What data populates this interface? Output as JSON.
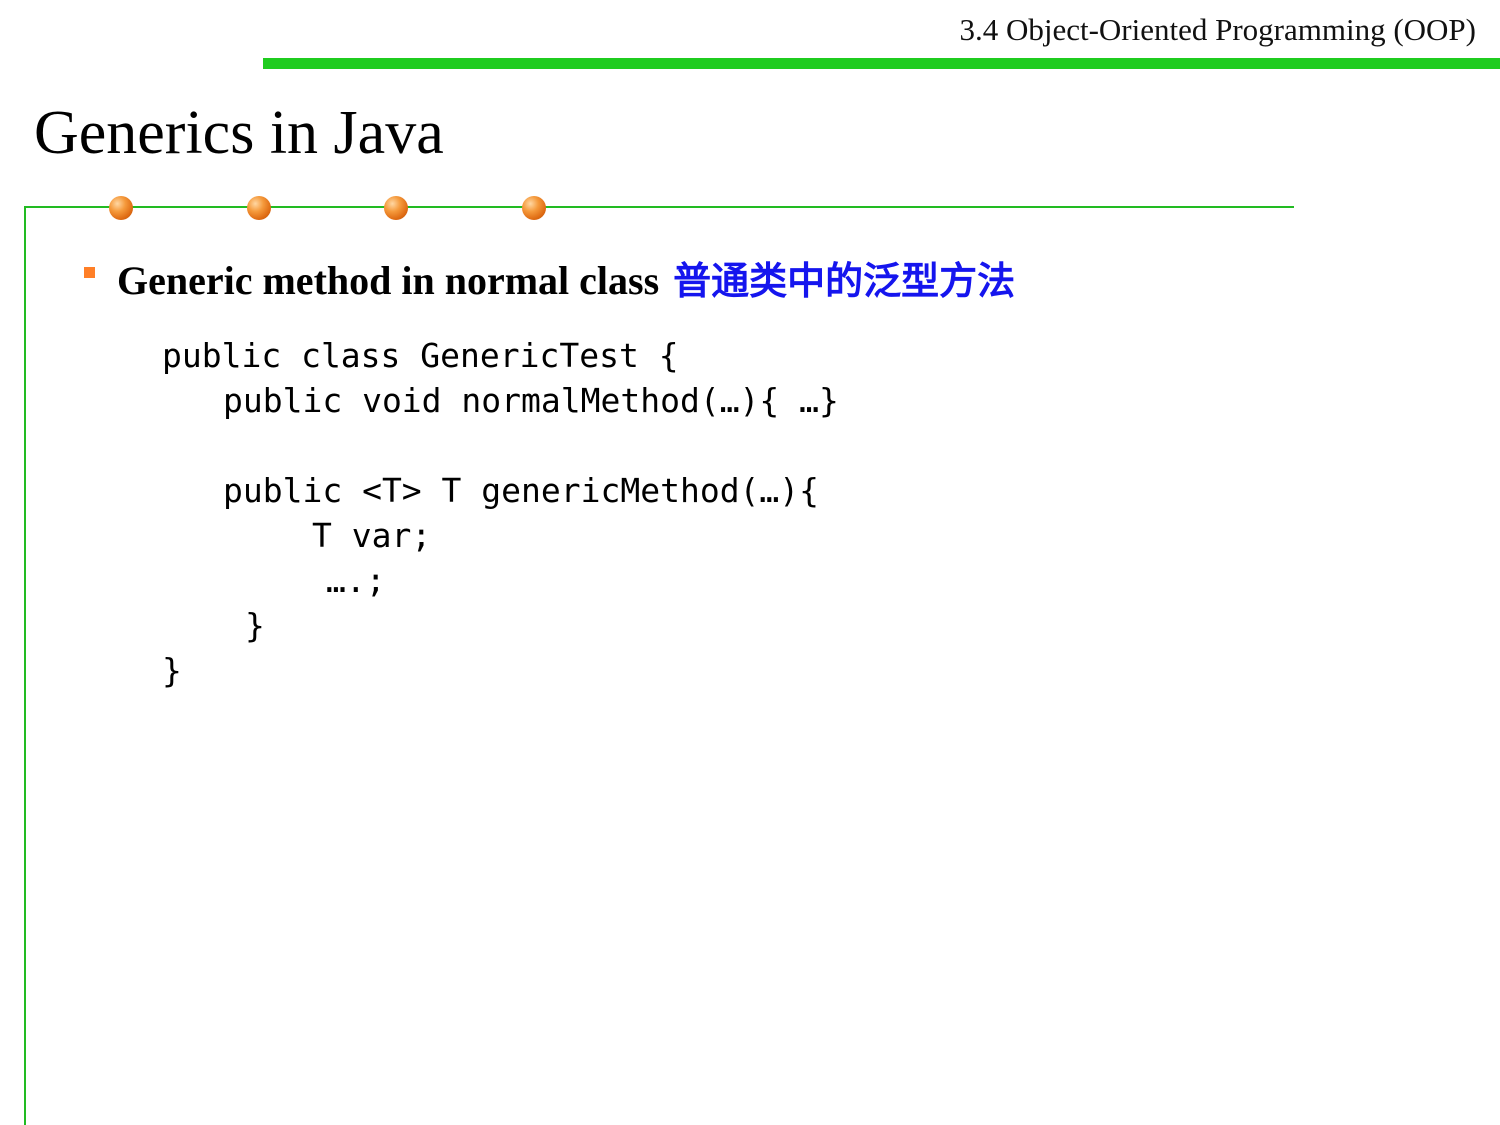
{
  "header": {
    "section_title": "3.4 Object-Oriented Programming (OOP)"
  },
  "slide": {
    "title": "Generics in Java",
    "bullet": {
      "text_en": "Generic method in normal class",
      "text_cn": "普通类中的泛型方法"
    },
    "code": [
      "public class GenericTest {",
      "public void normalMethod(…){ …}",
      "public <T> T genericMethod(…){",
      "T var;",
      "….;",
      "}",
      "}"
    ]
  },
  "colors": {
    "accent_green": "#1fcc1f",
    "frame_green": "#22bb22",
    "bullet_orange": "#ff7f27",
    "dot_orange": "#de6a12",
    "chinese_text_blue": "#1515ee"
  }
}
